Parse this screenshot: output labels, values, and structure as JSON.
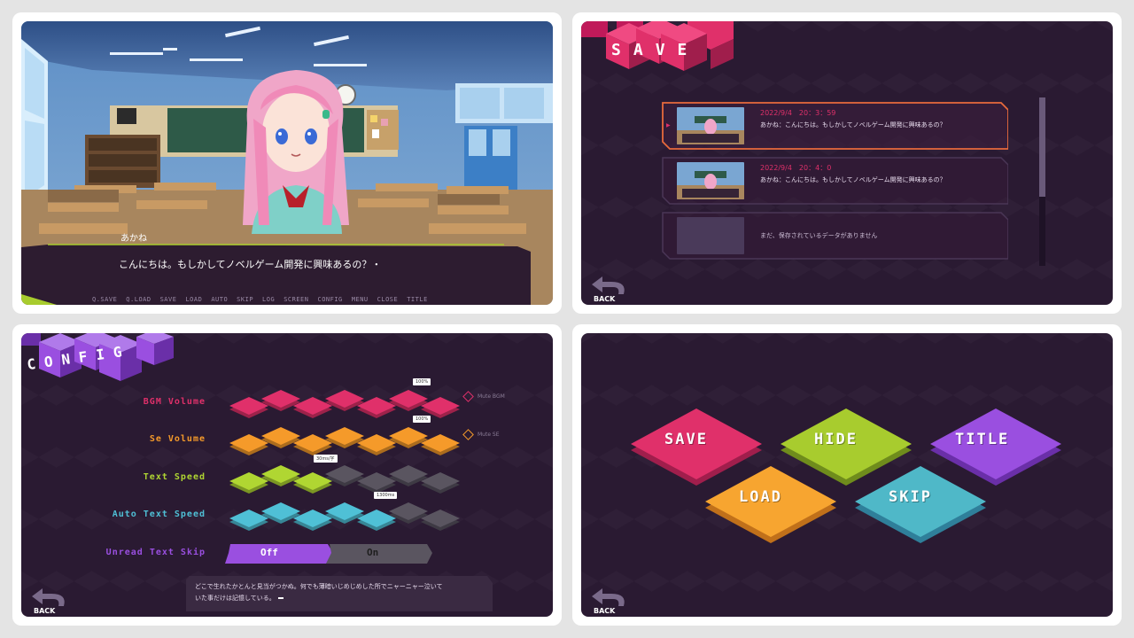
{
  "novel": {
    "speaker_name": "あかね",
    "dialogue": "こんにちは。もしかしてノベルゲーム開発に興味あるの？・",
    "menu": [
      "Q.SAVE",
      "Q.LOAD",
      "SAVE",
      "LOAD",
      "AUTO",
      "SKIP",
      "LOG",
      "SCREEN",
      "CONFIG",
      "MENU",
      "CLOSE",
      "TITLE"
    ]
  },
  "save_screen": {
    "title_letters": [
      "S",
      "A",
      "V",
      "E"
    ],
    "slots": [
      {
        "date": "2022/9/4　20：3：59",
        "text": "あかね：こんにちは。もしかしてノベルゲーム開発に興味あるの？",
        "selected": true
      },
      {
        "date": "2022/9/4　20：4：0",
        "text": "あかね：こんにちは。もしかしてノベルゲーム開発に興味あるの？",
        "selected": false
      },
      {
        "date": "",
        "text": "まだ、保存されているデータがありません",
        "selected": false
      }
    ],
    "back_label": "BACK"
  },
  "config_screen": {
    "title_letters": [
      "C",
      "O",
      "N",
      "F",
      "I",
      "G"
    ],
    "rows": [
      {
        "label": "BGM Volume",
        "color": "#e0306a",
        "level": 1.0,
        "tooltip": "100%",
        "mute_label": "Mute BGM"
      },
      {
        "label": "Se Volume",
        "color": "#f59a2a",
        "level": 1.0,
        "tooltip": "100%",
        "mute_label": "Mute SE"
      },
      {
        "label": "Text Speed",
        "color": "#b0d632",
        "level": 0.43,
        "tooltip": "30ms/字"
      },
      {
        "label": "Auto Text Speed",
        "color": "#4fc0d6",
        "level": 0.71,
        "tooltip": "1300ms"
      }
    ],
    "unread_skip": {
      "label": "Unread Text Skip",
      "off": "Off",
      "on": "On",
      "selected": "Off"
    },
    "sample_text_line1": "どこで生れたかとんと見当がつかぬ。何でも薄暗いじめじめした所でニャーニャー泣いて",
    "sample_text_line2": "いた事だけは記憶している。",
    "back_label": "BACK"
  },
  "menu_screen": {
    "buttons": [
      {
        "label": "SAVE",
        "color": "#e0306a",
        "side": "#a01e4c"
      },
      {
        "label": "HIDE",
        "color": "#a8cc2e",
        "side": "#6f8c1c"
      },
      {
        "label": "TITLE",
        "color": "#9a4fe0",
        "side": "#6a2fa8"
      },
      {
        "label": "LOAD",
        "color": "#f7a530",
        "side": "#c0701a"
      },
      {
        "label": "SKIP",
        "color": "#4fb8c8",
        "side": "#2f7f9a"
      }
    ],
    "back_label": "BACK"
  }
}
